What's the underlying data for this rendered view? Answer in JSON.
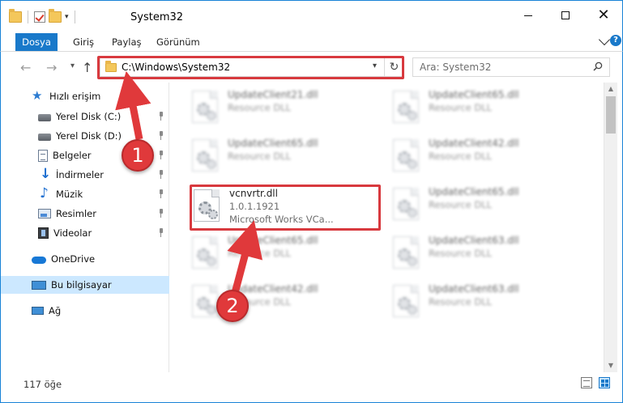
{
  "window": {
    "title": "System32",
    "quick_access_arrow": "▾"
  },
  "ribbon": {
    "tabs": [
      "Dosya",
      "Giriş",
      "Paylaş",
      "Görünüm"
    ]
  },
  "address_bar": {
    "path": "C:\\Windows\\System32",
    "search_placeholder": "Ara: System32"
  },
  "nav_pane": {
    "items": [
      {
        "label": "Hızlı erişim",
        "icon": "star-icon"
      },
      {
        "label": "Yerel Disk (C:)",
        "icon": "drive-icon",
        "pinned": true
      },
      {
        "label": "Yerel Disk (D:)",
        "icon": "drive-icon",
        "pinned": true
      },
      {
        "label": "Belgeler",
        "icon": "documents-icon",
        "pinned": true
      },
      {
        "label": "İndirmeler",
        "icon": "downloads-icon",
        "pinned": true
      },
      {
        "label": "Müzik",
        "icon": "music-icon",
        "pinned": true
      },
      {
        "label": "Resimler",
        "icon": "pictures-icon",
        "pinned": true
      },
      {
        "label": "Videolar",
        "icon": "videos-icon",
        "pinned": true
      },
      {
        "label": "OneDrive",
        "icon": "cloud-icon"
      },
      {
        "label": "Bu bilgisayar",
        "icon": "computer-icon",
        "selected": true
      },
      {
        "label": "Ağ",
        "icon": "network-icon"
      }
    ]
  },
  "files": {
    "col1": [
      {
        "name": "UpdateClient21.dll",
        "desc": "Resource DLL"
      },
      {
        "name": "UpdateClient65.dll",
        "desc": "Resource DLL"
      },
      {
        "name": "vcnvrtr.dll",
        "version": "1.0.1.1921",
        "desc": "Microsoft Works VCa..."
      },
      {
        "name": "UpdateClient65.dll",
        "desc": "Resource DLL"
      },
      {
        "name": "UpdateClient42.dll",
        "desc": "Resource DLL"
      }
    ],
    "col2": [
      {
        "name": "UpdateClient65.dll",
        "desc": "Resource DLL"
      },
      {
        "name": "UpdateClient42.dll",
        "desc": "Resource DLL"
      },
      {
        "name": "UpdateClient65.dll",
        "desc": "Resource DLL"
      },
      {
        "name": "UpdateClient63.dll",
        "desc": "Resource DLL"
      },
      {
        "name": "UpdateClient63.dll",
        "desc": "Resource DLL"
      }
    ]
  },
  "status_bar": {
    "item_count": "117 öğe"
  },
  "annotations": {
    "callout_1": "1",
    "callout_2": "2",
    "color": "#e0393b"
  }
}
